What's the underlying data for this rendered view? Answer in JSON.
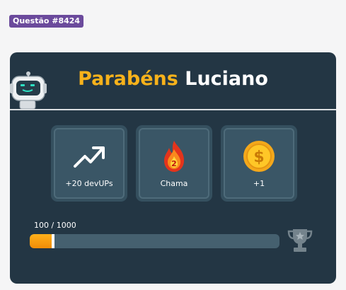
{
  "question_badge": "Questão #8424",
  "card": {
    "title_highlight": "Parabéns",
    "title_name": "Luciano"
  },
  "rewards": [
    {
      "icon": "trending-up-icon",
      "label": "+20 devUPs"
    },
    {
      "icon": "flame-icon",
      "label": "Chama",
      "badge_value": "2"
    },
    {
      "icon": "coin-icon",
      "label": "+1"
    }
  ],
  "progress": {
    "text": "100 / 1000",
    "current": 100,
    "max": 1000
  },
  "colors": {
    "card_bg": "#233644",
    "accent_orange": "#f7b21b",
    "badge_purple": "#6b4a9c"
  }
}
